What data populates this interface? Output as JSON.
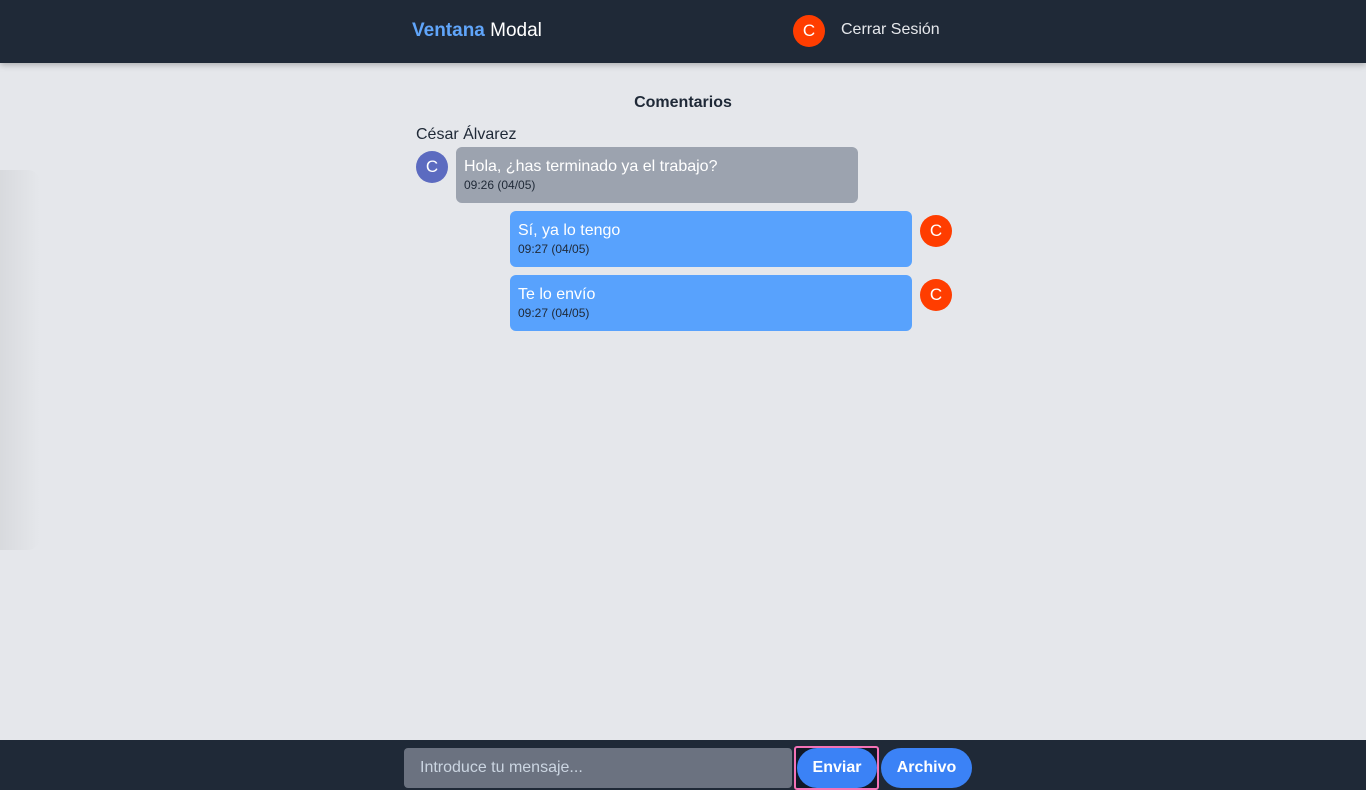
{
  "header": {
    "brand_accent": "Ventana",
    "brand_rest": "Modal",
    "user_initial": "C",
    "logout_label": "Cerrar Sesión"
  },
  "comments": {
    "title": "Comentarios",
    "author": "César Álvarez",
    "messages": [
      {
        "from": "other",
        "initial": "C",
        "text": "Hola, ¿has terminado ya el trabajo?",
        "time": "09:26 (04/05)"
      },
      {
        "from": "me",
        "initial": "C",
        "text": "Sí, ya lo tengo",
        "time": "09:27 (04/05)"
      },
      {
        "from": "me",
        "initial": "C",
        "text": "Te lo envío",
        "time": "09:27 (04/05)"
      }
    ]
  },
  "composer": {
    "placeholder": "Introduce tu mensaje...",
    "value": "",
    "send_label": "Enviar",
    "file_label": "Archivo"
  },
  "colors": {
    "header_bg": "#1f2937",
    "page_bg": "#e5e7eb",
    "accent": "#60a5fa",
    "avatar_me": "#ff3d00",
    "avatar_other": "#5c6bc0",
    "bubble_other": "#9ca3af",
    "bubble_me": "#58a2fd",
    "button": "#3b82f6"
  }
}
